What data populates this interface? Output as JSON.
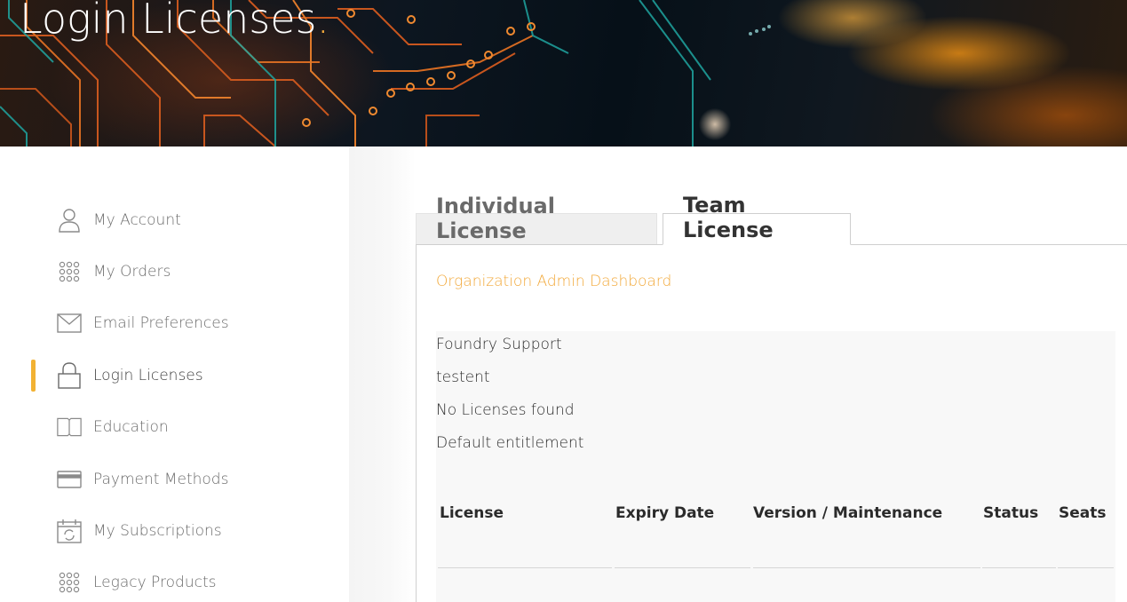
{
  "hero": {
    "title": "Login Licenses",
    "title_accent": ".",
    "accent_color": "#f2a93b"
  },
  "sidebar": {
    "items": [
      {
        "label": "My Account",
        "icon": "user-icon"
      },
      {
        "label": "My Orders",
        "icon": "grid-dots-icon"
      },
      {
        "label": "Email Preferences",
        "icon": "envelope-icon"
      },
      {
        "label": "Login Licenses",
        "icon": "lock-icon",
        "active": true
      },
      {
        "label": "Education",
        "icon": "book-icon"
      },
      {
        "label": "Payment Methods",
        "icon": "credit-card-icon"
      },
      {
        "label": "My Subscriptions",
        "icon": "calendar-refresh-icon"
      },
      {
        "label": "Legacy Products",
        "icon": "grid-dots-icon"
      }
    ],
    "active_color": "#f2b233"
  },
  "tabs": {
    "individual": "Individual License",
    "team": "Team License",
    "selected": "Team License"
  },
  "panel": {
    "org_link": "Organization Admin Dashboard",
    "org_name": "Foundry Support",
    "team_name": "testent",
    "licenses_status": "No Licenses found",
    "entitlement": "Default entitlement"
  },
  "table": {
    "headers": [
      "License",
      "Expiry Date",
      "Version / Maintenance",
      "Status",
      "Seats"
    ]
  }
}
